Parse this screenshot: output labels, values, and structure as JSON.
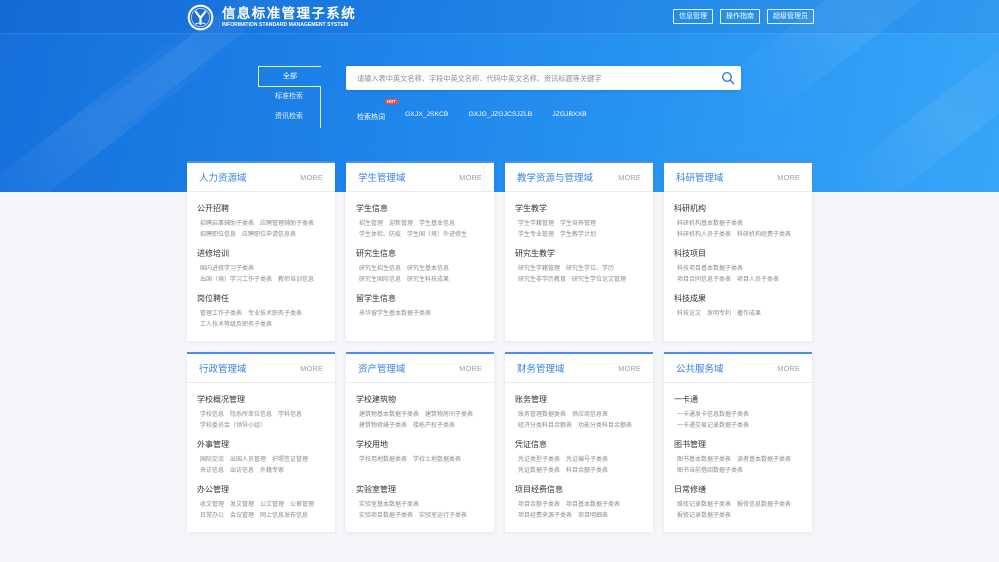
{
  "header": {
    "logo_icon": "university-logo-icon",
    "title": "信息标准管理子系统",
    "subtitle": "INFORMATION STANDARD MANAGEMENT SYSTEM",
    "buttons": [
      "信息管理",
      "操作指南",
      "超级管理员"
    ]
  },
  "search": {
    "tabs": [
      "全部",
      "标准检索",
      "资讯检索"
    ],
    "active_tab_index": 0,
    "placeholder": "请输入表中英文名称、字段中英文名称、代码中英文名称、资讯标题等关键字",
    "search_icon": "search-icon",
    "hot_label": "检索热词",
    "hot_badge": "HOT",
    "hot_words": [
      "GXJX_JSKCB",
      "GXJG_JZGJCSJZLB",
      "JZGJBXXB"
    ]
  },
  "card_more_label": "MORE",
  "domains": [
    {
      "title": "人力资源域",
      "sections": [
        {
          "title": "公开招聘",
          "rows": [
            [
              "招聘启事辅助子类表",
              "应聘管理辅助子类表"
            ],
            [
              "招聘职位信息",
              "应聘职位申请信息表"
            ]
          ]
        },
        {
          "title": "进修培训",
          "rows": [
            [
              "国内进修学习子类表"
            ],
            [
              "出国（境）学习工作子类表",
              "教师培训信息"
            ]
          ]
        },
        {
          "title": "岗位聘任",
          "rows": [
            [
              "管理工作子类表",
              "专业技术职务子类表"
            ],
            [
              "工人技术等级及职务子类表"
            ]
          ]
        }
      ]
    },
    {
      "title": "学生管理域",
      "sections": [
        {
          "title": "学生信息",
          "rows": [
            [
              "招生管理",
              "迎新管理",
              "学生基本信息"
            ],
            [
              "学生体检、防疫",
              "学生国（境）外进修生"
            ]
          ]
        },
        {
          "title": "研究生信息",
          "rows": [
            [
              "研究生招生信息",
              "研究生基本信息"
            ],
            [
              "研究生国际信息",
              "研究生科技成果"
            ]
          ]
        },
        {
          "title": "留学生信息",
          "rows": [
            [
              "来华留学生基本数据子类表"
            ]
          ]
        }
      ]
    },
    {
      "title": "教学资源与管理域",
      "sections": [
        {
          "title": "学生教学",
          "rows": [
            [
              "学生学籍管理",
              "学生培养管理"
            ],
            [
              "学生专业管理",
              "学生教学计划"
            ]
          ]
        },
        {
          "title": "研究生教学",
          "rows": [
            [
              "研究生学籍管理",
              "研究生学位、学历"
            ],
            [
              "研究生非学历教育",
              "研究生学位论文管理"
            ]
          ]
        }
      ]
    },
    {
      "title": "科研管理域",
      "sections": [
        {
          "title": "科研机构",
          "rows": [
            [
              "科研机构基本数据子类表"
            ],
            [
              "科研机构人员子类表",
              "科研机构经费子类表"
            ]
          ]
        },
        {
          "title": "科技项目",
          "rows": [
            [
              "科技项目基本数据子类表"
            ],
            [
              "项目合同信息子类表",
              "项目人员子类表"
            ]
          ]
        },
        {
          "title": "科技成果",
          "rows": [
            [
              "科技论文",
              "发明专利",
              "著作成果"
            ]
          ]
        }
      ]
    },
    {
      "title": "行政管理域",
      "sections": [
        {
          "title": "学校概况管理",
          "rows": [
            [
              "学校信息",
              "院系所单位信息",
              "学科信息"
            ],
            [
              "学校委员会（领导小组）"
            ]
          ]
        },
        {
          "title": "外事管理",
          "rows": [
            [
              "国际交流",
              "出国人员管理",
              "护照签证管理"
            ],
            [
              "来访信息",
              "出访信息",
              "外籍专家"
            ]
          ]
        },
        {
          "title": "办公管理",
          "rows": [
            [
              "收文管理",
              "发文管理",
              "公文管理",
              "公章管理"
            ],
            [
              "日常办公",
              "会议管理",
              "网上信息发布信息"
            ]
          ]
        }
      ]
    },
    {
      "title": "资产管理域",
      "sections": [
        {
          "title": "学校建筑物",
          "rows": [
            [
              "建筑物基本数据子类表",
              "建筑物房间子类表"
            ],
            [
              "建筑物修缮子类表",
              "楼栋产权子类表"
            ]
          ]
        },
        {
          "title": "学校用地",
          "rows": [
            [
              "学校用地数据类表",
              "学校土地数据类表"
            ]
          ]
        },
        {
          "title": "实验室管理",
          "rows": [
            [
              "实验室基本数据子类表"
            ],
            [
              "实验项目数据子类表",
              "实验室运行子类表"
            ]
          ]
        }
      ]
    },
    {
      "title": "财务管理域",
      "sections": [
        {
          "title": "账务管理",
          "rows": [
            [
              "账务管理数据类表",
              "供应商信息表"
            ],
            [
              "经济分类科目余额表",
              "功能分类科目余额表"
            ]
          ]
        },
        {
          "title": "凭证信息",
          "rows": [
            [
              "凭证类型子类表",
              "凭证编号子类表"
            ],
            [
              "凭证数据子类表",
              "科目余额子类表"
            ]
          ]
        },
        {
          "title": "项目经费信息",
          "rows": [
            [
              "项目余额子类表",
              "项目基本数据子类表"
            ],
            [
              "项目经费来源子类表",
              "项目明细表"
            ]
          ]
        }
      ]
    },
    {
      "title": "公共服务域",
      "sections": [
        {
          "title": "一卡通",
          "rows": [
            [
              "一卡通发卡信息数据子类表"
            ],
            [
              "一卡通交易记录数据子类表"
            ]
          ]
        },
        {
          "title": "图书管理",
          "rows": [
            [
              "图书基本数据子类表",
              "读者基本数据子类表"
            ],
            [
              "图书当前借阅数据子类表"
            ]
          ]
        },
        {
          "title": "日常修缮",
          "rows": [
            [
              "维修记录数据子类表",
              "报修信息数据子类表"
            ],
            [
              "报修记录数据子类表"
            ]
          ]
        }
      ]
    }
  ],
  "colors": {
    "banner_blue": "#1e84ea",
    "card_accent": "#4a90ee",
    "card_title": "#3683e2",
    "search_icon": "#2f7de1",
    "hot_badge": "#f04a3c",
    "page_background": "#f4f6f9"
  }
}
